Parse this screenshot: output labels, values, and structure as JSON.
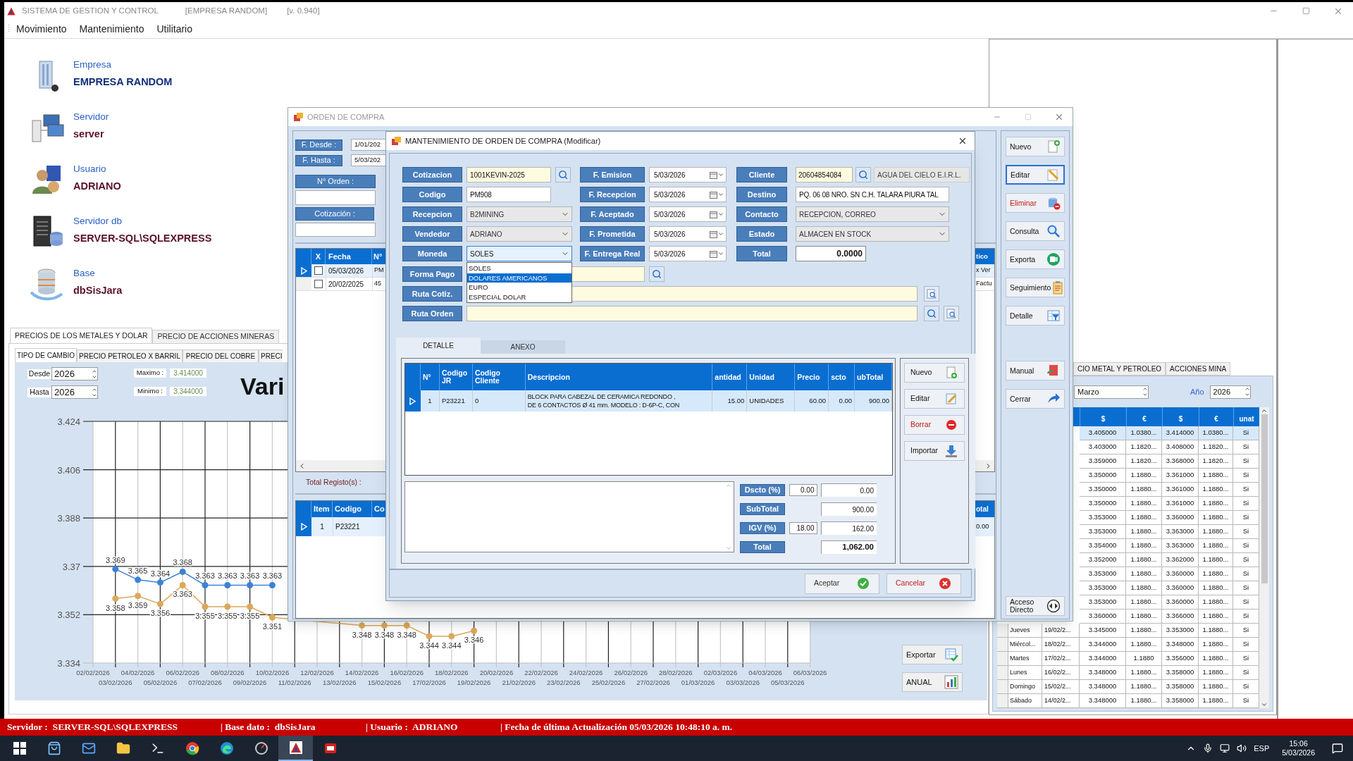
{
  "app": {
    "title": "SISTEMA DE GESTION Y CONTROL",
    "company": "[EMPRESA RANDOM]",
    "version": "[v. 0.940]"
  },
  "menu": [
    {
      "label": "Movimiento"
    },
    {
      "label": "Mantenimiento"
    },
    {
      "label": "Utilitario"
    }
  ],
  "info": [
    {
      "kind": "company",
      "label": "Empresa",
      "value": "EMPRESA RANDOM"
    },
    {
      "kind": "server",
      "label": "Servidor",
      "value": "server"
    },
    {
      "kind": "user",
      "label": "Usuario",
      "value": "ADRIANO"
    },
    {
      "kind": "dbserver",
      "label": "Servidor db",
      "value": "SERVER-SQL\\SQLEXPRESS"
    },
    {
      "kind": "database",
      "label": "Base",
      "value": "dbSisJara"
    }
  ],
  "metals": {
    "tabs": [
      {
        "label": "PRECIOS DE LOS METALES Y DOLAR",
        "selected": true
      },
      {
        "label": "PRECIO DE ACCIONES MINERAS",
        "selected": false
      }
    ],
    "subtabs": [
      {
        "label": "TIPO DE CAMBIO",
        "selected": true
      },
      {
        "label": "PRECIO PETROLEO X BARRIL",
        "selected": false
      },
      {
        "label": "PRECIO DEL COBRE",
        "selected": false
      },
      {
        "label": "PRECI",
        "selected": false
      }
    ],
    "from": {
      "label": "Desde",
      "value": "2026"
    },
    "to": {
      "label": "Hasta",
      "value": "2026"
    },
    "max": {
      "label": "Maximo :",
      "value": "3.414000"
    },
    "min": {
      "label": "Minimo :",
      "value": "3.344000"
    },
    "title": "Vari",
    "chart_data": {
      "type": "line",
      "categories": [
        "02/02/2026",
        "03/02/2026",
        "04/02/2026",
        "05/02/2026",
        "06/02/2026",
        "07/02/2026",
        "08/02/2026",
        "09/02/2026",
        "10/02/2026",
        "11/02/2026",
        "12/02/2026",
        "13/02/2026",
        "14/02/2026",
        "15/02/2026",
        "16/02/2026",
        "17/02/2026",
        "18/02/2026",
        "19/02/2026",
        "20/02/2026",
        "21/02/2026",
        "22/02/2026",
        "23/02/2026",
        "24/02/2026",
        "25/02/2026",
        "26/02/2026",
        "27/02/2026",
        "28/02/2026",
        "01/03/2026",
        "02/03/2026",
        "03/03/2026",
        "04/03/2026",
        "05/03/2026",
        "06/03/2026"
      ],
      "series": [
        {
          "color": "#3b82d6",
          "marker": "circle",
          "values": [
            null,
            3.369,
            3.365,
            3.364,
            3.368,
            3.363,
            3.363,
            3.363,
            3.363,
            null,
            null,
            null,
            null,
            null,
            null,
            null,
            null,
            null,
            null,
            null,
            null,
            null,
            null,
            null,
            null,
            null,
            null,
            null,
            null,
            null,
            null,
            null,
            null
          ]
        },
        {
          "color": "#dca85a",
          "marker": "circle",
          "values": [
            null,
            3.358,
            3.359,
            3.356,
            3.363,
            3.355,
            3.355,
            3.355,
            3.351,
            null,
            null,
            null,
            3.348,
            3.348,
            3.348,
            3.344,
            3.344,
            3.346,
            null,
            null,
            null,
            null,
            null,
            null,
            null,
            null,
            null,
            null,
            null,
            null,
            null,
            null,
            null
          ]
        }
      ],
      "ylim": [
        3.334,
        3.424
      ],
      "yticks": [
        3.334,
        3.352,
        3.37,
        3.388,
        3.406,
        3.424
      ],
      "data_labels": true,
      "grid": true
    },
    "buttons": [
      {
        "label": "Exportar",
        "kind": "export_sheet"
      },
      {
        "label": "ANUAL",
        "kind": "annual"
      }
    ]
  },
  "exchange": {
    "tabs": [
      {
        "label": "CIO METAL Y PETROLEO"
      },
      {
        "label": "ACCIONES MINA"
      }
    ],
    "month": "Marzo",
    "year_label": "Año",
    "year": "2026",
    "columns": [
      "$",
      "€",
      "$",
      "€",
      "unat"
    ],
    "rows": [
      {
        "selected": true,
        "cells": [
          "3.405000",
          "1.0380...",
          "3.414000",
          "1.0380...",
          "Si"
        ]
      },
      {
        "selected": false,
        "cells": [
          "3.403000",
          "1.1820...",
          "3.408000",
          "1.1820...",
          "Si"
        ]
      },
      {
        "selected": false,
        "cells": [
          "3.359000",
          "1.1820...",
          "3.368000",
          "1.1820...",
          "Si"
        ]
      },
      {
        "selected": false,
        "cells": [
          "3.350000",
          "1.1880...",
          "3.361000",
          "1.1880...",
          "Si"
        ]
      },
      {
        "selected": false,
        "cells": [
          "3.350000",
          "1.1880...",
          "3.361000",
          "1.1880...",
          "Si"
        ]
      },
      {
        "selected": false,
        "cells": [
          "3.350000",
          "1.1880...",
          "3.361000",
          "1.1880...",
          "Si"
        ]
      },
      {
        "selected": false,
        "cells": [
          "3.353000",
          "1.1880...",
          "3.360000",
          "1.1880...",
          "Si"
        ]
      },
      {
        "selected": false,
        "cells": [
          "3.353000",
          "1.1880...",
          "3.363000",
          "1.1880...",
          "Si"
        ]
      },
      {
        "selected": false,
        "cells": [
          "3.354000",
          "1.1880...",
          "3.363000",
          "1.1880...",
          "Si"
        ]
      },
      {
        "selected": false,
        "cells": [
          "3.352000",
          "1.1880...",
          "3.362000",
          "1.1880...",
          "Si"
        ]
      },
      {
        "selected": false,
        "cells": [
          "3.353000",
          "1.1880...",
          "3.360000",
          "1.1880...",
          "Si"
        ]
      },
      {
        "selected": false,
        "cells": [
          "3.353000",
          "1.1880...",
          "3.360000",
          "1.1880...",
          "Si"
        ]
      },
      {
        "selected": false,
        "cells": [
          "3.353000",
          "1.1880...",
          "3.360000",
          "1.1880...",
          "Si"
        ]
      },
      {
        "selected": false,
        "cells": [
          "3.360000",
          "1.1880...",
          "3.366000",
          "1.1880...",
          "Si"
        ]
      },
      {
        "selected": false,
        "day": "Jueves",
        "date": "19/02/2...",
        "cells": [
          "3.345000",
          "1.1880...",
          "3.353000",
          "1.1880...",
          "Si"
        ]
      },
      {
        "selected": false,
        "day": "Miércol...",
        "date": "18/02/2...",
        "cells": [
          "3.344000",
          "1.1880...",
          "3.348000",
          "1.1880...",
          "Si"
        ]
      },
      {
        "selected": false,
        "day": "Martes",
        "date": "17/02/2...",
        "cells": [
          "3.344000",
          "1.1880",
          "3.356000",
          "1.1880...",
          "Si"
        ]
      },
      {
        "selected": false,
        "day": "Lunes",
        "date": "16/02/2...",
        "cells": [
          "3.348000",
          "1.1880...",
          "3.358000",
          "1.1880...",
          "Si"
        ]
      },
      {
        "selected": false,
        "day": "Domingo",
        "date": "15/02/2...",
        "cells": [
          "3.348000",
          "1.1880...",
          "3.358000",
          "1.1880...",
          "Si"
        ]
      },
      {
        "selected": false,
        "day": "Sábado",
        "date": "14/02/2...",
        "cells": [
          "3.348000",
          "1.1880...",
          "3.358000",
          "1.1880...",
          "Si"
        ]
      }
    ]
  },
  "order_window": {
    "title": "ORDEN DE COMPRA",
    "filters": [
      {
        "label": "F. Desde :",
        "value": "1/01/202"
      },
      {
        "label": "F. Hasta :",
        "value": "5/03/202"
      }
    ],
    "order_no": "N° Orden :",
    "quote": "Cotización :",
    "list": {
      "columns": [
        "X",
        "Fecha",
        "N°"
      ],
      "last_column": "tico",
      "rows": [
        {
          "selected": true,
          "checked": false,
          "date": "05/03/2026",
          "number": "PM",
          "last": "x Ver"
        },
        {
          "selected": false,
          "checked": false,
          "date": "20/02/2025",
          "number": "45",
          "last": "Factu"
        }
      ]
    },
    "total_label": "Total Registo(s) :",
    "items": {
      "columns": [
        "Item",
        "Codigo",
        "Co"
      ],
      "last_column": "otal",
      "rows": [
        {
          "selected": true,
          "item": "1",
          "code": "P23221",
          "last": "0.00"
        }
      ]
    },
    "toolbar": [
      {
        "label": "Nuevo",
        "kind": "new",
        "selected": false
      },
      {
        "label": "Editar",
        "kind": "edit",
        "selected": true
      },
      {
        "label": "Eliminar",
        "kind": "delete",
        "selected": false
      },
      {
        "label": "Consulta",
        "kind": "query",
        "selected": false
      },
      {
        "label": "Exporta",
        "kind": "export",
        "selected": false
      },
      {
        "label": "Seguimiento",
        "kind": "track",
        "selected": false
      },
      {
        "label": "Detalle",
        "kind": "detail",
        "selected": false
      },
      {
        "label": "Manual",
        "kind": "manual",
        "selected": false
      },
      {
        "label": "Cerrar",
        "kind": "close",
        "selected": false
      },
      {
        "label": "Acceso Directo",
        "kind": "shortcut",
        "selected": false
      }
    ]
  },
  "modal": {
    "title": "MANTENIMIENTO DE ORDEN DE COMPRA (Modificar)",
    "col1": [
      {
        "kind": "lookup",
        "label": "Cotizacion",
        "value": "1001KEVIN-2025"
      },
      {
        "kind": "text",
        "label": "Codigo",
        "value": "PM908"
      },
      {
        "kind": "combo",
        "label": "Recepcion",
        "value": "B2MINING",
        "expanded": false
      },
      {
        "kind": "combo",
        "label": "Vendedor",
        "value": "ADRIANO",
        "expanded": false
      },
      {
        "kind": "combo",
        "label": "Moneda",
        "value": "SOLES",
        "expanded": true,
        "options": [
          {
            "label": "SOLES",
            "highlighted": false
          },
          {
            "label": "DOLARES AMERICANOS",
            "highlighted": true
          },
          {
            "label": "EURO",
            "highlighted": false
          },
          {
            "label": "ESPECIAL DOLAR",
            "highlighted": false
          }
        ]
      }
    ],
    "col2": [
      {
        "kind": "date",
        "label": "F. Emision",
        "value": "5/03/2026"
      },
      {
        "kind": "date",
        "label": "F. Recepcion",
        "value": "5/03/2026"
      },
      {
        "kind": "date",
        "label": "F. Aceptado",
        "value": "5/03/2026"
      },
      {
        "kind": "date",
        "label": "F. Prometida",
        "value": "5/03/2026"
      },
      {
        "kind": "date",
        "label": "F. Entrega Real",
        "value": "5/03/2026"
      }
    ],
    "col3": [
      {
        "kind": "client",
        "label": "Cliente",
        "value": "20604854084",
        "name": "AGUA DEL CIELO E.I.R.L."
      },
      {
        "kind": "text",
        "label": "Destino",
        "value": "PQ. 06 08 NRO. SN C.H. TALARA PIURA TAL"
      },
      {
        "kind": "combo",
        "label": "Contacto",
        "value": "RECEPCION, CORREO",
        "expanded": false
      },
      {
        "kind": "combo",
        "label": "Estado",
        "value": "ALMACEN EN STOCK",
        "expanded": false
      },
      {
        "kind": "total",
        "label": "Total",
        "value": "0.0000"
      }
    ],
    "rows": [
      {
        "kind": "lookup",
        "label": "Forma Pago"
      },
      {
        "kind": "path",
        "label": "Ruta Cotiz."
      },
      {
        "kind": "path_search",
        "label": "Ruta Orden"
      }
    ],
    "tabs": [
      {
        "label": "DETALLE",
        "selected": true
      },
      {
        "label": "ANEXO",
        "selected": false
      }
    ],
    "grid": {
      "columns": [
        "N°",
        "Codigo JR",
        "Codigo Cliente",
        "Descripcion",
        "antidad",
        "Unidad",
        "Precio",
        "scto",
        "ubTotal"
      ],
      "rows": [
        {
          "selected": true,
          "cells": [
            "1",
            "P23221",
            "0",
            "BLOCK PARA CABEZAL DE CERAMICA REDONDO ,\nDE 6 CONTACTOS Ø 41 mm. MODELO : D-6P-C, CON",
            "15.00",
            "UNIDADES",
            "60.00",
            "0.00",
            "900.00"
          ]
        }
      ]
    },
    "grid_buttons": [
      {
        "label": "Nuevo",
        "kind": "new_row"
      },
      {
        "label": "Editar",
        "kind": "edit_row"
      },
      {
        "label": "Borrar",
        "kind": "remove"
      },
      {
        "label": "Importar",
        "kind": "import"
      }
    ],
    "totals": [
      {
        "kind": "plain",
        "label": "Dscto (%)",
        "rate": "0.00",
        "value": "0.00"
      },
      {
        "kind": "plain",
        "label": "SubTotal",
        "value": "900.00"
      },
      {
        "kind": "plain",
        "label": "IGV (%)",
        "rate": "18.00",
        "value": "162.00"
      },
      {
        "kind": "total",
        "label": "Total",
        "value": "1,062.00"
      }
    ],
    "buttons": [
      {
        "label": "Aceptar",
        "kind": "accept"
      },
      {
        "label": "Cancelar",
        "kind": "cancel"
      }
    ]
  },
  "status": [
    {
      "text": "Servidor :  SERVER-SQL\\SQLEXPRESS"
    },
    {
      "text": "| Base dato :  dbSisJara"
    },
    {
      "text": "| Usuario :  ADRIANO"
    },
    {
      "text": "| Fecha de última Actualización 05/03/2026 10:48:10 a. m."
    }
  ],
  "taskbar": {
    "apps": [
      {
        "kind": "start",
        "selected": false
      },
      {
        "kind": "store",
        "selected": false
      },
      {
        "kind": "mail",
        "selected": false
      },
      {
        "kind": "files",
        "selected": false
      },
      {
        "kind": "terminal",
        "selected": false
      },
      {
        "kind": "chrome",
        "selected": false
      },
      {
        "kind": "edge",
        "selected": false
      },
      {
        "kind": "gauge",
        "selected": false
      },
      {
        "kind": "app",
        "selected": true
      },
      {
        "kind": "red_app",
        "selected": false
      }
    ],
    "language": "ESP",
    "time": "15:06",
    "date": "5/03/2026"
  }
}
